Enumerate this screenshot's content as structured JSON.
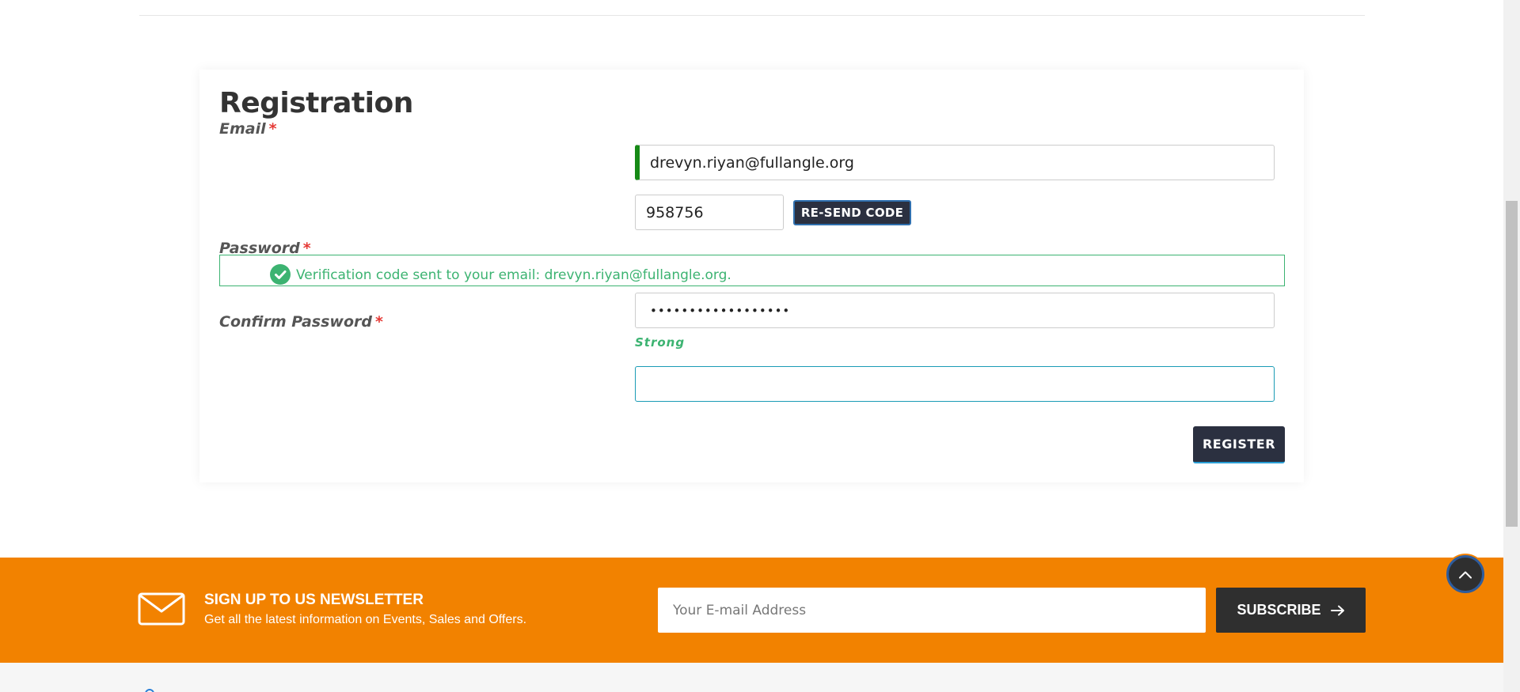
{
  "registration": {
    "title": "Registration",
    "email": {
      "label": "Email",
      "required_mark": "*",
      "value": "drevyn.riyan@fullangle.org"
    },
    "verification": {
      "code_value": "958756",
      "resend_label": "RE-SEND CODE",
      "alert_text": "Verification code sent to your email: drevyn.riyan@fullangle.org."
    },
    "password": {
      "label": "Password",
      "required_mark": "*",
      "value": "••••••••••••••••••",
      "strength": "Strong"
    },
    "confirm_password": {
      "label": "Confirm Password",
      "required_mark": "*",
      "value": ""
    },
    "register_label": "REGISTER"
  },
  "newsletter": {
    "title": "SIGN UP TO US NEWSLETTER",
    "subtitle": "Get all the latest information on Events, Sales and Offers.",
    "email_placeholder": "Your E-mail Address",
    "subscribe_label": "SUBSCRIBE"
  },
  "colors": {
    "accent_orange": "#f28200",
    "dark_button": "#2b3040",
    "success_green": "#3cb371",
    "email_valid_bar": "#168a16",
    "required_red": "#e53935"
  },
  "icons": {
    "alert": "check-circle-icon",
    "newsletter": "mail-icon",
    "subscribe": "arrow-right-icon",
    "scroll_top": "chevron-up-icon"
  }
}
